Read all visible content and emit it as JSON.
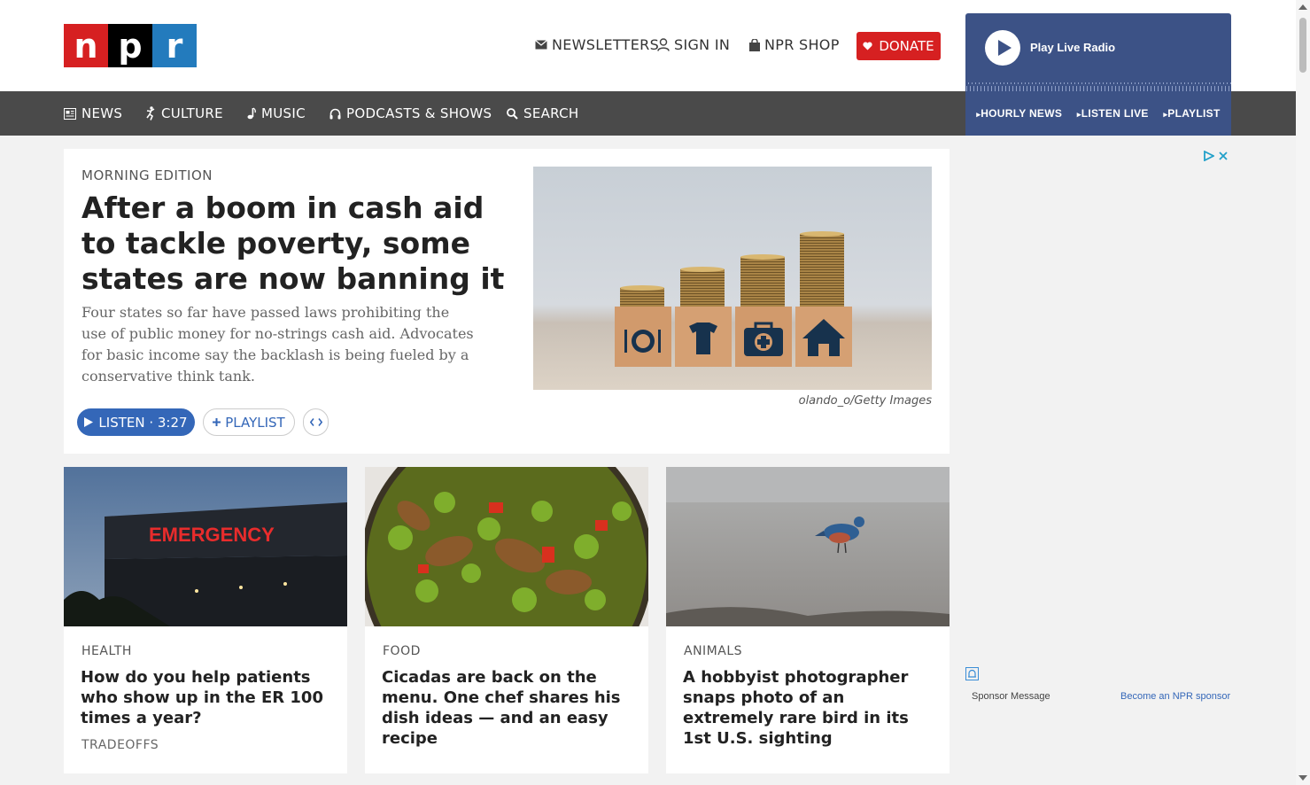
{
  "logo": {
    "letters": [
      "n",
      "p",
      "r"
    ]
  },
  "header": {
    "newsletters": "NEWSLETTERS",
    "sign_in": "SIGN IN",
    "shop": "NPR SHOP",
    "donate": "DONATE"
  },
  "nav": {
    "news": "NEWS",
    "culture": "CULTURE",
    "music": "MUSIC",
    "podcasts": "PODCASTS & SHOWS",
    "search": "SEARCH"
  },
  "live_radio": {
    "label": "Play Live Radio",
    "links": [
      "HOURLY NEWS",
      "LISTEN LIVE",
      "PLAYLIST"
    ]
  },
  "featured": {
    "slug": "MORNING EDITION",
    "headline": "After a boom in cash aid to tackle poverty, some states are now banning it",
    "teaser": "Four states so far have passed laws prohibiting the use of public money for no-strings cash aid. Advocates for basic income say the backlash is being fueled by a conservative think tank.",
    "listen": "LISTEN · 3:27",
    "playlist": "PLAYLIST",
    "credit": "olando_o/Getty Images"
  },
  "cards": [
    {
      "slug": "HEALTH",
      "headline": "How do you help patients who show up in the ER 100 times a year?",
      "show": "TRADEOFFS",
      "sign": "EMERGENCY"
    },
    {
      "slug": "FOOD",
      "headline": "Cicadas are back on the menu. One chef shares his dish ideas — and an easy recipe"
    },
    {
      "slug": "ANIMALS",
      "headline": "A hobbyist photographer snaps photo of an extremely rare bird in its 1st U.S. sighting"
    }
  ],
  "sponsor": {
    "message": "Sponsor Message",
    "link": "Become an NPR sponsor"
  },
  "colors": {
    "npr_red": "#d62021",
    "npr_blue": "#237bbd",
    "nav_bg": "#4a4a4a",
    "radio_bg": "#3c5286",
    "link_blue": "#3467b8"
  }
}
